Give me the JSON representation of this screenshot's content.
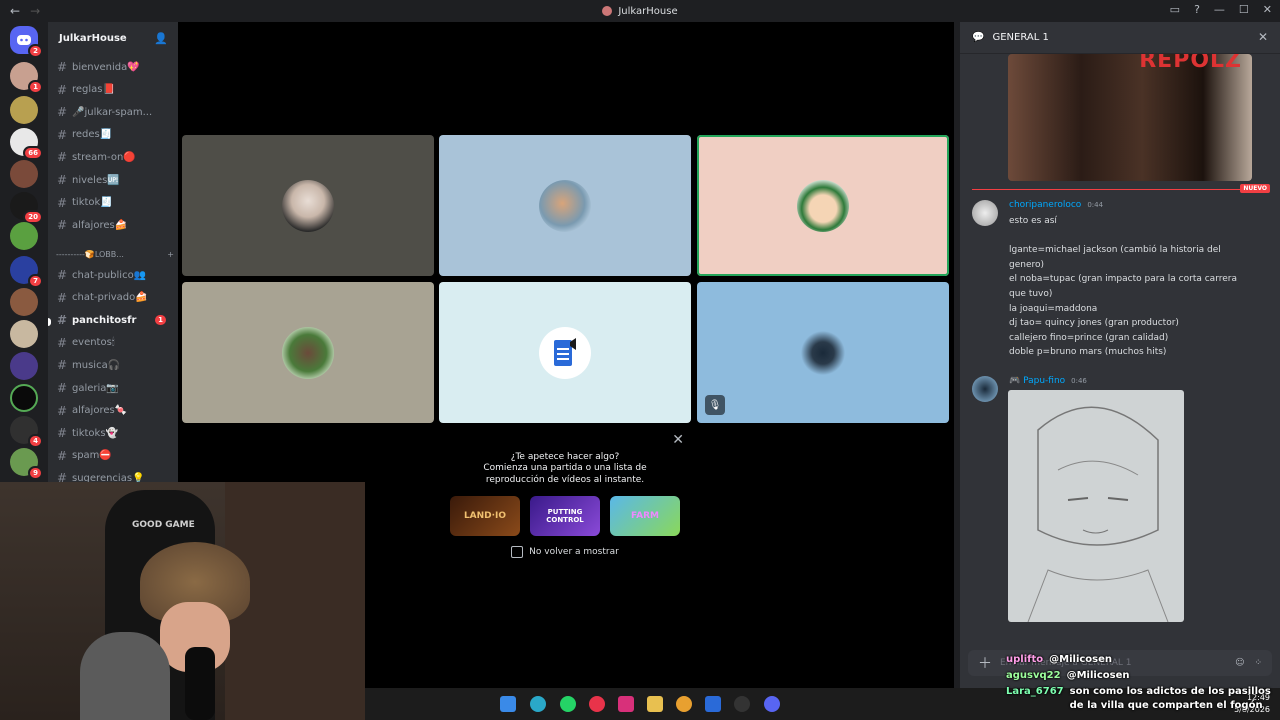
{
  "window": {
    "title": "JulkarHouse"
  },
  "server": {
    "name": "JulkarHouse",
    "home_badge": "2"
  },
  "rail_badges": [
    "1",
    "66",
    "20",
    "7",
    "4",
    "9"
  ],
  "channels": [
    {
      "name": "bienvenida💖"
    },
    {
      "name": "reglas📕"
    },
    {
      "name": "🎤julkar-spam..."
    },
    {
      "name": "redes🧾"
    },
    {
      "name": "stream-on🔴"
    },
    {
      "name": "niveles🆙"
    },
    {
      "name": "tiktok🧾"
    },
    {
      "name": "alfajores🍰"
    }
  ],
  "category": {
    "name": "----------🍞LOBB...",
    "add": "+"
  },
  "lobby_channels": [
    {
      "name": "chat-publico👥",
      "active": false,
      "badge": ""
    },
    {
      "name": "chat-privado🍰",
      "active": false,
      "badge": ""
    },
    {
      "name": "panchitosfr",
      "active": true,
      "badge": "1"
    },
    {
      "name": "eventos🕯",
      "active": false,
      "badge": ""
    },
    {
      "name": "musica🎧",
      "active": false,
      "badge": ""
    },
    {
      "name": "galeria📷",
      "active": false,
      "badge": ""
    },
    {
      "name": "alfajores🍬",
      "active": false,
      "badge": ""
    },
    {
      "name": "tiktoks👻",
      "active": false,
      "badge": ""
    },
    {
      "name": "spam⛔",
      "active": false,
      "badge": ""
    },
    {
      "name": "sugerencias💡",
      "active": false,
      "badge": ""
    }
  ],
  "activity": {
    "title": "¿Te apetece hacer algo?",
    "subtitle": "Comienza una partida o una lista de reproducción de vídeos al instante.",
    "games": [
      "LAND·IO",
      "PUTTING CONTROL",
      "FARM"
    ],
    "dont_show": "No volver a mostrar"
  },
  "chat": {
    "channel": "GENERAL 1",
    "image_overlay_text": "REPOLZ",
    "new_label": "NUEVO",
    "messages": [
      {
        "author": "choripaneroloco",
        "time": "0:44",
        "lines": [
          "esto es así",
          "",
          "lgante=michael jackson (cambió la historia del genero)",
          "el noba=tupac (gran impacto para la corta carrera que tuvo)",
          "la joaqui=maddona",
          "dj tao= quincy jones (gran productor)",
          "callejero fino=prince (gran calidad)",
          "doble p=bruno mars (muchos hits)"
        ]
      },
      {
        "author": "🎮 Papu-fino",
        "time": "0:46",
        "lines": []
      }
    ],
    "composer_placeholder": "Enviar mensaje a GENERAL 1"
  },
  "overlay_chat": [
    {
      "user": "uplifto",
      "text": "@Milicosen",
      "color": "#ff9ee8"
    },
    {
      "user": "agusvq22",
      "text": "@Milicosen",
      "color": "#9dff9d"
    },
    {
      "user": "Lara_6767",
      "text": "son como los adictos de los pasillos de la villa que comparten el fogón",
      "color": "#7dffb0"
    }
  ],
  "webcam": {
    "chair_text": "GOOD GAME"
  },
  "taskbar": {
    "time": "12:49",
    "date": "5/8/2026"
  }
}
